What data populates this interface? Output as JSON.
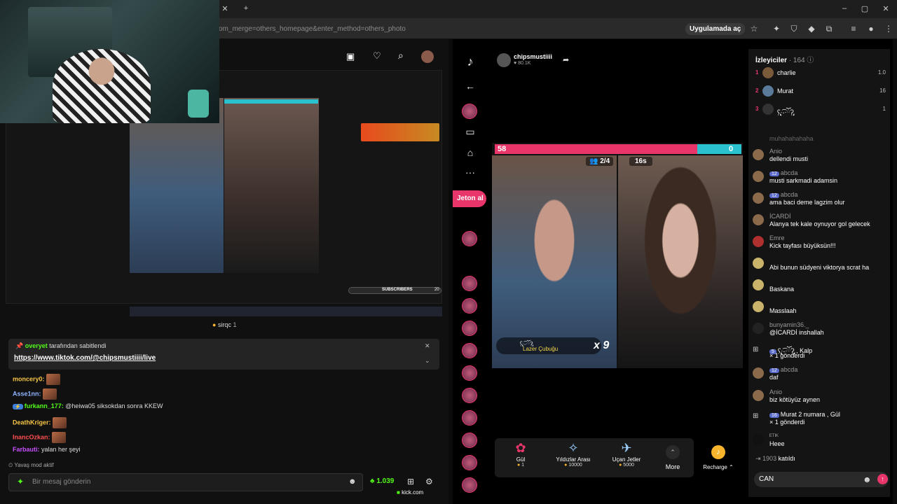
{
  "browser": {
    "url_fragment": "om_merge=others_homepage&enter_method=others_photo",
    "open_in_app": "Uygulamada aç"
  },
  "stream": {
    "viewer_name": "sirqc",
    "viewer_count": "1",
    "studio_subs_label": "SUBSCRIBERS",
    "studio_subs_count": "20"
  },
  "kick_chat": {
    "pinned_by_user": "overyet",
    "pinned_by_suffix": "tarafından sabitlendi",
    "pinned_link": "https://www.tiktok.com/@chipsmustiiii/live",
    "messages": [
      {
        "user": "moncery0:",
        "color": "#f6c546",
        "text": ""
      },
      {
        "user": "Asse1nn:",
        "color": "#8fb4ff",
        "text": ""
      },
      {
        "user": "furkann_177:",
        "color": "#53fc18",
        "text": "@heiwa05 siksokdan sonra KKEW"
      },
      {
        "user": "DeathKriger:",
        "color": "#f6c546",
        "text": ""
      },
      {
        "user": "InancOzkan:",
        "color": "#ff4f4f",
        "text": ""
      },
      {
        "user": "Farbauti:",
        "color": "#c74fff",
        "text": "yalan her şeyi"
      }
    ],
    "slow_mode": "Yavaş mod aktif",
    "placeholder": "Bir mesaj gönderin",
    "kick_count": "1.039",
    "footer": "kick.com"
  },
  "tiktok": {
    "host_name": "chipsmustiiii",
    "host_likes": "80.1K",
    "jeton_label": "Jeton al",
    "score_left": "58",
    "score_right": "0",
    "players": "2/4",
    "timer": "16s",
    "gift_sender": "Lazer Çubuğu",
    "gift_multiplier": "x 9",
    "gifts": [
      {
        "name": "Gül",
        "price": "1"
      },
      {
        "name": "Yıldızlar Arası",
        "price": "10000"
      },
      {
        "name": "Uçan Jetler",
        "price": "5000"
      }
    ],
    "more_label": "More",
    "recharge_label": "Recharge"
  },
  "tt_chat": {
    "viewers_title": "İzleyiciler",
    "viewers_count": "· 164",
    "ranking": [
      {
        "rank": "1",
        "name": "charlie",
        "value": "1.0"
      },
      {
        "rank": "2",
        "name": "Murat",
        "value": "16"
      },
      {
        "rank": "3",
        "name": "ʕ̢̣̣̣̣̩̩̩̩·͡˔·ོɁ̡̣̣̣̣̩̩̩̩",
        "value": "1"
      }
    ],
    "faded_line": "muhahahahaha",
    "messages": [
      {
        "user": "Anio",
        "text": "dellendi musti"
      },
      {
        "user": "abcda",
        "badge": "12",
        "text": "musti sarkmadi adamsin"
      },
      {
        "user": "abcda",
        "badge": "12",
        "text": "ama baci deme lagzim olur"
      },
      {
        "user": "İCARDİ",
        "text": "Alanya tek kale oynuyor gol gelecek"
      },
      {
        "user": "Emre",
        "text": "Kick tayfası büyüksün!!!"
      },
      {
        "user": "",
        "text": "Abi bunun südyeni viktorya scrat ha"
      },
      {
        "user": "",
        "text": "Baskana"
      },
      {
        "user": "",
        "text": "Masslaah"
      },
      {
        "user": "bunyamin36._",
        "text": "@İCARDİ inshallah"
      },
      {
        "user": "ʕ̢̣̣̣̣̩̩̩̩·͡˔·ོɁ̡̣̣̣̣̩̩̩̩ , Kalp",
        "badge": "5",
        "text": "× 1 gönderdi"
      },
      {
        "user": "abcda",
        "badge": "12",
        "text": "daf"
      },
      {
        "user": "Anio",
        "text": "biz kötüyüz aynen"
      },
      {
        "user": "Murat  2 numara , Gül",
        "badge": "16",
        "text": "× 1 gönderdi"
      },
      {
        "user": "ᴱᵀᴵᴷ",
        "text": "Heee"
      }
    ],
    "joined_user": "1903",
    "joined_text": "katıldı",
    "input_value": "CAN"
  }
}
